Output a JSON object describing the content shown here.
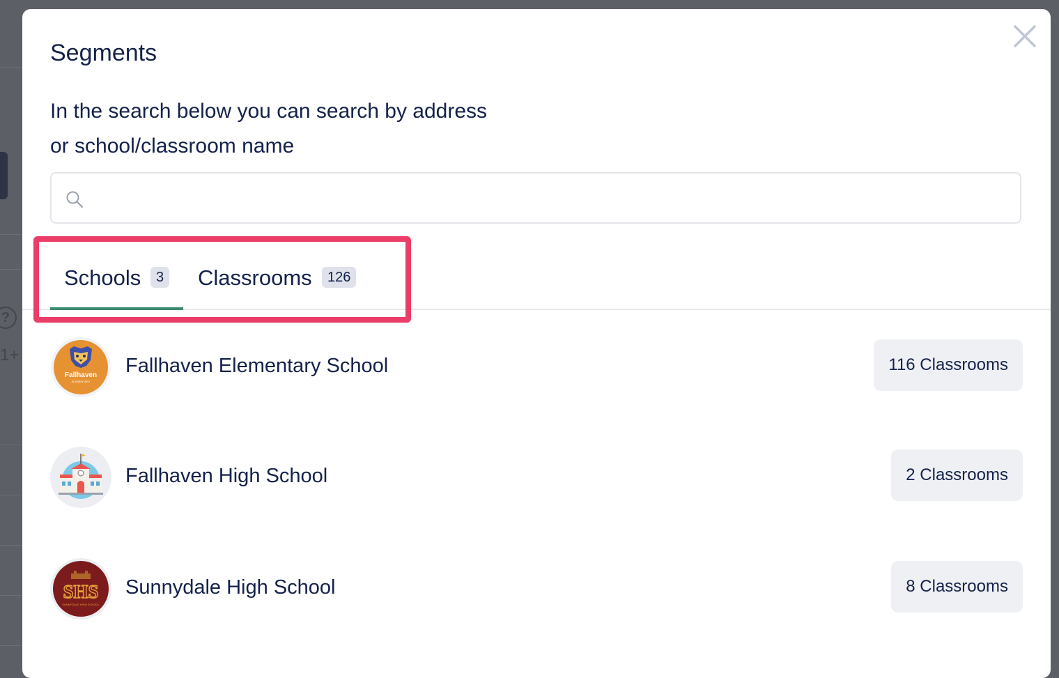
{
  "modal": {
    "title": "Segments",
    "description_line1": "In the search below you can search by address",
    "description_line2": "or school/classroom name",
    "close_icon": "close-icon"
  },
  "search": {
    "value": "",
    "placeholder": "",
    "icon": "search-icon"
  },
  "tabs": [
    {
      "label": "Schools",
      "count": "3",
      "active": true
    },
    {
      "label": "Classrooms",
      "count": "126",
      "active": false
    }
  ],
  "schools": [
    {
      "name": "Fallhaven Elementary School",
      "classrooms": "116 Classrooms",
      "logo": "fallhaven-elementary-logo",
      "logo_text": "Fallhaven",
      "logo_subtext": "ELEMENTARY"
    },
    {
      "name": "Fallhaven High School",
      "classrooms": "2 Classrooms",
      "logo": "school-building-icon"
    },
    {
      "name": "Sunnydale High School",
      "classrooms": "8 Classrooms",
      "logo": "sunnydale-logo",
      "logo_text": "SHS",
      "logo_subtext": "SUNNYDALE HIGH SCHOOL"
    }
  ],
  "background": {
    "help_glyph": "?",
    "partial_text": "1+"
  },
  "colors": {
    "accent_tab_underline": "#3a8a70",
    "highlight_box": "#ea3d67",
    "text_primary": "#14214a",
    "badge_bg": "#dfe2ea",
    "count_button_bg": "#eef0f4"
  }
}
